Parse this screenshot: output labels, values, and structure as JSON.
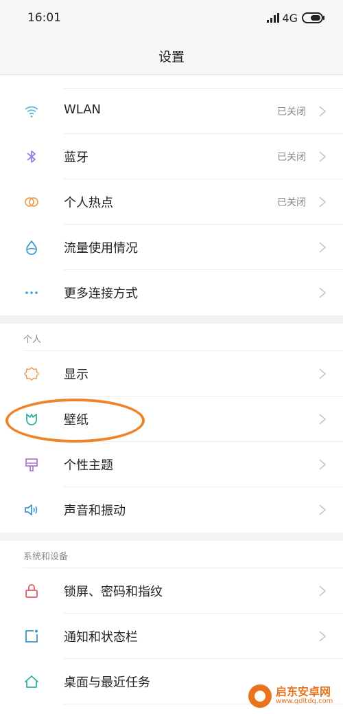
{
  "status": {
    "time": "16:01",
    "network": "4G"
  },
  "header": {
    "title": "设置"
  },
  "connectivity": [
    {
      "name": "wlan",
      "label": "WLAN",
      "value": "已关闭",
      "icon": "wifi-icon",
      "color": "#5bb8d6"
    },
    {
      "name": "bluetooth",
      "label": "蓝牙",
      "value": "已关闭",
      "icon": "bluetooth-icon",
      "color": "#9b7fe0"
    },
    {
      "name": "hotspot",
      "label": "个人热点",
      "value": "已关闭",
      "icon": "hotspot-icon",
      "color": "#f0a050"
    },
    {
      "name": "data-usage",
      "label": "流量使用情况",
      "value": "",
      "icon": "drop-icon",
      "color": "#3a98d0"
    },
    {
      "name": "more-connections",
      "label": "更多连接方式",
      "value": "",
      "icon": "more-dots-icon",
      "color": "#3a98d0"
    }
  ],
  "personal": {
    "header": "个人",
    "items": [
      {
        "name": "display",
        "label": "显示",
        "icon": "sun-icon",
        "color": "#f0a050"
      },
      {
        "name": "wallpaper",
        "label": "壁纸",
        "icon": "tulip-icon",
        "color": "#2bb3a0"
      },
      {
        "name": "theme",
        "label": "个性主题",
        "icon": "brush-icon",
        "color": "#b07cd8"
      },
      {
        "name": "sound",
        "label": "声音和振动",
        "icon": "speaker-icon",
        "color": "#3a98d0"
      }
    ]
  },
  "system": {
    "header": "系统和设备",
    "items": [
      {
        "name": "lockscreen",
        "label": "锁屏、密码和指纹",
        "icon": "lock-icon",
        "color": "#e05a6a"
      },
      {
        "name": "notifications",
        "label": "通知和状态栏",
        "icon": "notification-icon",
        "color": "#3a98d0"
      },
      {
        "name": "home",
        "label": "桌面与最近任务",
        "icon": "home-icon",
        "color": "#2bb3a0"
      }
    ]
  },
  "watermark": {
    "cn": "启东安卓网",
    "url": "www.qdltdq.com",
    "color": "#e8731c"
  },
  "annotation": {
    "color": "#ee8327"
  }
}
